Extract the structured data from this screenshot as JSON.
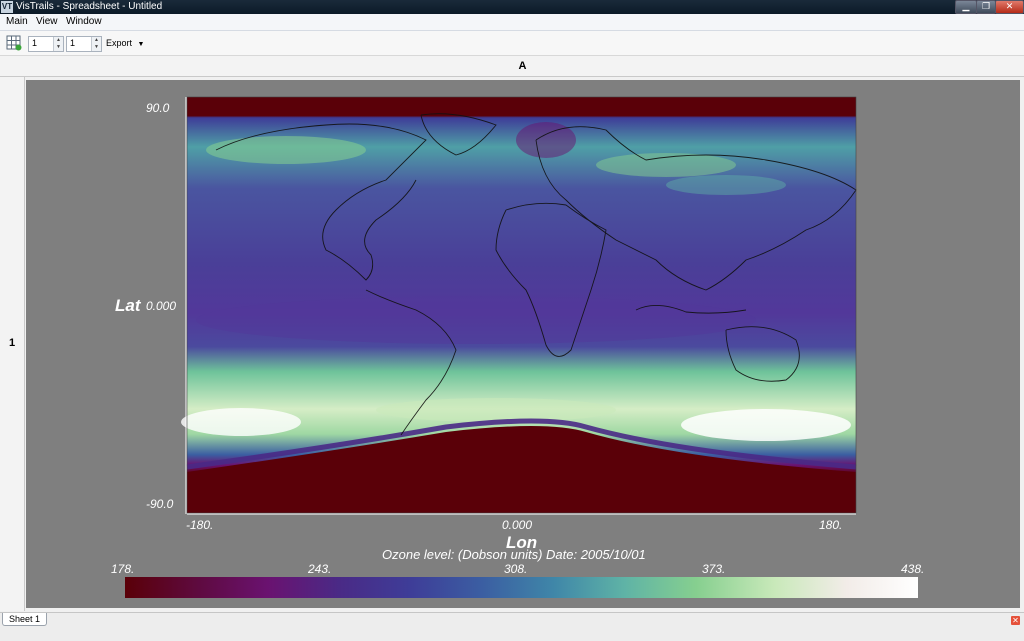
{
  "window": {
    "title": "VisTrails - Spreadsheet - Untitled",
    "app_icon": "VT"
  },
  "menu": {
    "items": [
      "Main",
      "View",
      "Window"
    ]
  },
  "toolbar": {
    "rows_value": "1",
    "cols_value": "1",
    "export_label": "Export"
  },
  "sheet": {
    "column_header": "A",
    "row_header": "1",
    "tab_label": "Sheet 1"
  },
  "map": {
    "y_tick_top": "90.0",
    "y_tick_mid": "0.000",
    "y_tick_bottom": "-90.0",
    "y_axis_label": "Lat",
    "x_tick_left": "-180.",
    "x_tick_mid": "0.000",
    "x_tick_right": "180.",
    "x_axis_label": "Lon",
    "caption": "Ozone level: (Dobson units) Date: 2005/10/01"
  },
  "colorbar": {
    "ticks": [
      "178.",
      "243.",
      "308.",
      "373.",
      "438."
    ],
    "colors": [
      "#5a0008",
      "#5e0a3e",
      "#6a1270",
      "#4a2a86",
      "#3e3d98",
      "#3b5ea2",
      "#3f86a8",
      "#5fb3a6",
      "#86cf8f",
      "#c9e9ba",
      "#f2ece8",
      "#ffffff"
    ]
  },
  "chart_data": {
    "type": "heatmap",
    "title": "",
    "xlabel": "Lon",
    "ylabel": "Lat",
    "xlim": [
      -180,
      180
    ],
    "ylim": [
      -90,
      90
    ],
    "colorbar_range": [
      178,
      438
    ],
    "colorbar_ticks": [
      178,
      243,
      308,
      373,
      438
    ],
    "caption": "Ozone level: (Dobson units) Date: 2005/10/01"
  }
}
